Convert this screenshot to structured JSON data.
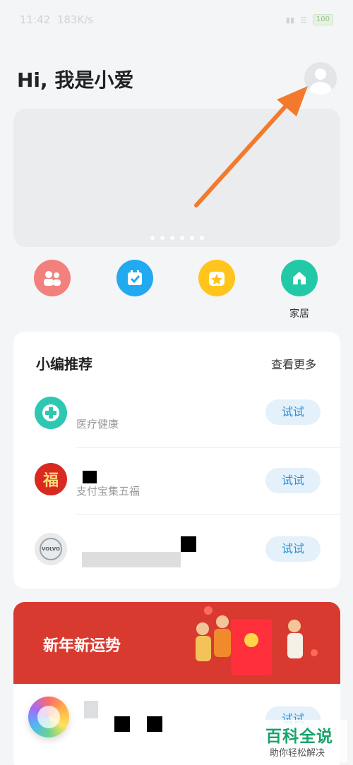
{
  "status_bar": {
    "time": "11:42",
    "speed": "183K/s",
    "battery": "100"
  },
  "header": {
    "greeting": "Hi, 我是小爱"
  },
  "banner": {
    "page_count": 6
  },
  "quick_actions": [
    {
      "label": "",
      "color": "#f2807c",
      "icon": "family-icon"
    },
    {
      "label": "",
      "color": "#22aaf0",
      "icon": "calendar-check-icon"
    },
    {
      "label": "",
      "color": "#ffc51c",
      "icon": "star-icon"
    },
    {
      "label": "家居",
      "color": "#23c9a6",
      "icon": "home-icon"
    }
  ],
  "recommend": {
    "title": "小编推荐",
    "more": "查看更多",
    "items": [
      {
        "title": "",
        "subtitle": "医疗健康",
        "button": "试试",
        "icon": "health-cross-icon"
      },
      {
        "title": "",
        "subtitle": "支付宝集五福",
        "button": "试试",
        "icon": "fu-icon",
        "icon_text": "福"
      },
      {
        "title": "",
        "subtitle": "",
        "button": "试试",
        "icon": "volvo-icon",
        "icon_text": "VOLVO"
      }
    ]
  },
  "new_year": {
    "title": "新年新运势",
    "button": "试试"
  },
  "watermark": {
    "brand": "百科全说",
    "slogan": "助你轻松解决"
  },
  "colors": {
    "accent": "#2f8ed2",
    "arrow": "#f37a2c",
    "red_banner": "#d93a30"
  }
}
